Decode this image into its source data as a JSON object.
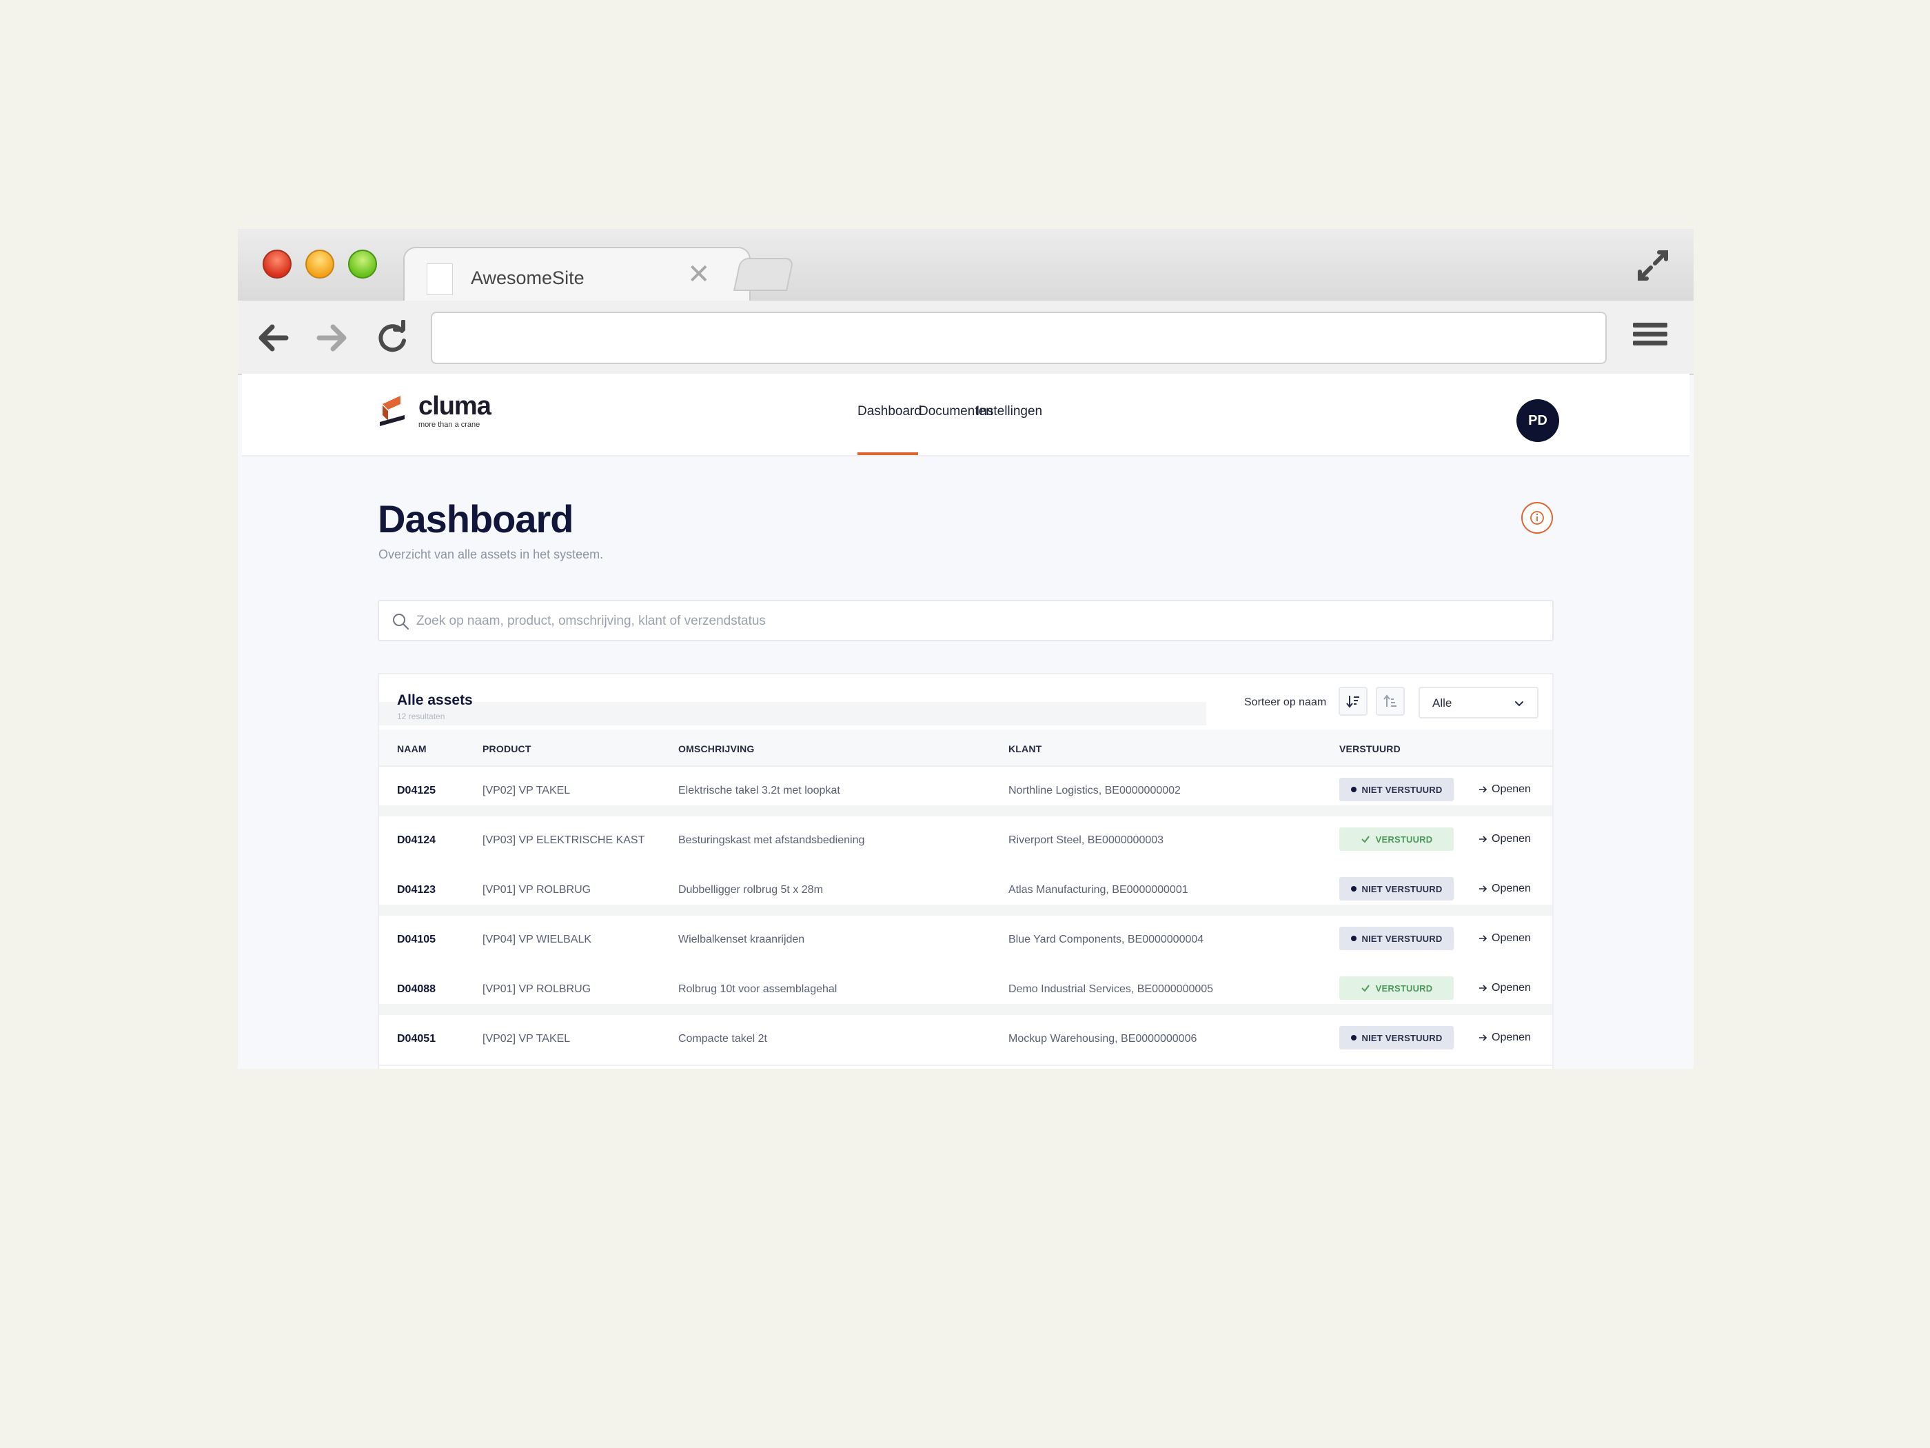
{
  "browser": {
    "tab_title": "AwesomeSite",
    "tab_close": "✕",
    "url": ""
  },
  "app": {
    "logo": {
      "word": "cluma",
      "tagline": "more than a crane"
    },
    "nav": [
      {
        "label": "Dashboard",
        "active": true
      },
      {
        "label": "Documenten",
        "active": false
      },
      {
        "label": "Instellingen",
        "active": false
      }
    ],
    "accent_color": "#e06530",
    "avatar_initials": "PD"
  },
  "page": {
    "title": "Dashboard",
    "subtitle": "Overzicht van alle assets in het systeem."
  },
  "search": {
    "placeholder": "Zoek op naam, product, omschrijving, klant of verzendstatus",
    "value": ""
  },
  "assets": {
    "title": "Alle assets",
    "count": "12 resultaten",
    "sort_label": "Sorteer op naam",
    "filter_value": "Alle",
    "columns": [
      "NAAM",
      "PRODUCT",
      "OMSCHRIJVING",
      "KLANT",
      "VERSTUURD"
    ],
    "open_label": "Openen",
    "rows": [
      {
        "name": "D04125",
        "product": "[VP02] VP TAKEL",
        "description": "Elektrische takel 3.2t met loopkat",
        "client": "Northline Logistics, BE0000000002",
        "status": "NIET VERSTUURD",
        "sent": false
      },
      {
        "name": "D04124",
        "product": "[VP03] VP ELEKTRISCHE KAST",
        "description": "Besturingskast met afstandsbediening",
        "client": "Riverport Steel, BE0000000003",
        "status": "VERSTUURD",
        "sent": true
      },
      {
        "name": "D04123",
        "product": "[VP01] VP ROLBRUG",
        "description": "Dubbelligger rolbrug 5t x 28m",
        "client": "Atlas Manufacturing, BE0000000001",
        "status": "NIET VERSTUURD",
        "sent": false
      },
      {
        "name": "D04105",
        "product": "[VP04] VP WIELBALK",
        "description": "Wielbalkenset kraanrijden",
        "client": "Blue Yard Components, BE0000000004",
        "status": "NIET VERSTUURD",
        "sent": false
      },
      {
        "name": "D04088",
        "product": "[VP01] VP ROLBRUG",
        "description": "Rolbrug 10t voor assemblagehal",
        "client": "Demo Industrial Services, BE0000000005",
        "status": "VERSTUURD",
        "sent": true
      },
      {
        "name": "D04051",
        "product": "[VP02] VP TAKEL",
        "description": "Compacte takel 2t",
        "client": "Mockup Warehousing, BE0000000006",
        "status": "NIET VERSTUURD",
        "sent": false
      }
    ]
  }
}
